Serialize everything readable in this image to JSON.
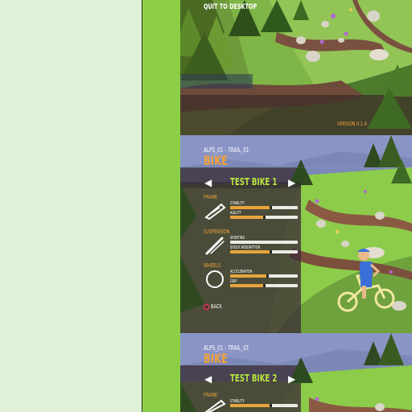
{
  "menu": {
    "quit_label": "QUIT TO DESKTOP",
    "version": "VERSION 0.1.4"
  },
  "screens": [
    {
      "level": "ALPS_01 - TRAIL_01",
      "section_title": "BIKE",
      "bike_name": "TEST BIKE 1",
      "prev_icon": "triangle-left-icon",
      "next_icon": "triangle-right-icon",
      "back_label": "BACK",
      "components": [
        {
          "name": "FRAME",
          "icon": "frame-icon",
          "stats": [
            {
              "label": "STABILITY",
              "value": 0.6
            },
            {
              "label": "AGILITY",
              "value": 0.5
            }
          ]
        },
        {
          "name": "SUSPENSION",
          "icon": "fork-icon",
          "stats": [
            {
              "label": "SPORTING",
              "value": 0.0
            },
            {
              "label": "SHOCK ABSORPTION",
              "value": 0.6
            }
          ]
        },
        {
          "name": "WHEELS",
          "icon": "wheel-icon",
          "stats": [
            {
              "label": "ACCELERATION",
              "value": 0.55
            },
            {
              "label": "GRIP",
              "value": 0.5
            }
          ]
        }
      ]
    },
    {
      "level": "ALPS_01 - TRAIL_01",
      "section_title": "BIKE",
      "bike_name": "TEST BIKE 2",
      "components": [
        {
          "name": "FRAME",
          "icon": "frame-icon",
          "stats": [
            {
              "label": "STABILITY",
              "value": 0.6
            }
          ]
        }
      ]
    }
  ],
  "colors": {
    "accent_orange": "#f0a23a",
    "bike_name_green": "#b7e83a",
    "stat_fill": "#e9a43c",
    "stat_track": "#ecebe6",
    "sidebar_green": "#8ccf47",
    "left_background": "#dff1d6"
  }
}
